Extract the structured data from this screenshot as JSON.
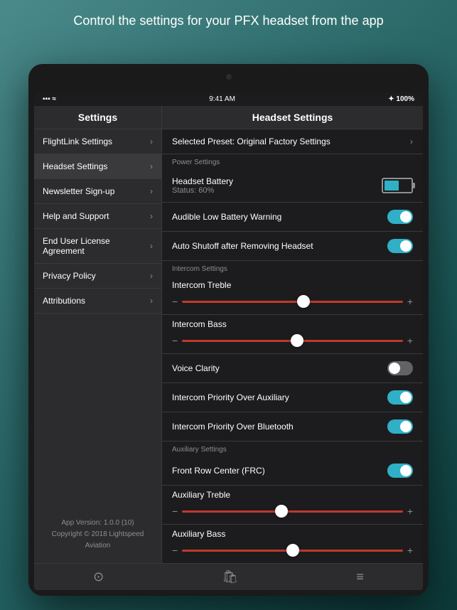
{
  "header": {
    "text": "Control the settings for your PFX headset from the app"
  },
  "status_bar": {
    "signal": "▪▪▪ ≈",
    "time": "9:41 AM",
    "battery": "✦ 100%"
  },
  "nav": {
    "left_title": "Settings",
    "right_title": "Headset Settings"
  },
  "sidebar": {
    "items": [
      {
        "label": "FlightLink Settings",
        "active": false
      },
      {
        "label": "Headset Settings",
        "active": true
      },
      {
        "label": "Newsletter Sign-up",
        "active": false
      },
      {
        "label": "Help and Support",
        "active": false
      },
      {
        "label": "End User License Agreement",
        "active": false
      },
      {
        "label": "Privacy Policy",
        "active": false
      },
      {
        "label": "Attributions",
        "active": false
      }
    ],
    "version": "App Version:  1.0.0 (10)",
    "copyright": "Copyright © 2018 Lightspeed Aviation"
  },
  "right_panel": {
    "selected_preset_label": "Selected Preset:  Original Factory Settings",
    "sections": [
      {
        "header": "Power Settings",
        "items": [
          {
            "type": "battery",
            "label": "Headset Battery",
            "sublabel": "Status:  60%",
            "percent": 60
          },
          {
            "type": "toggle",
            "label": "Audible Low Battery Warning",
            "on": true
          },
          {
            "type": "toggle",
            "label": "Auto Shutoff after Removing Headset",
            "on": true
          }
        ]
      },
      {
        "header": "Intercom Settings",
        "items": [
          {
            "type": "slider",
            "label": "Intercom Treble",
            "position": 0.55
          },
          {
            "type": "slider",
            "label": "Intercom Bass",
            "position": 0.52
          },
          {
            "type": "toggle",
            "label": "Voice Clarity",
            "on": false
          },
          {
            "type": "toggle",
            "label": "Intercom Priority Over Auxiliary",
            "on": true
          },
          {
            "type": "toggle",
            "label": "Intercom Priority Over Bluetooth",
            "on": true
          }
        ]
      },
      {
        "header": "Auxiliary Settings",
        "items": [
          {
            "type": "toggle",
            "label": "Front Row Center (FRC)",
            "on": true
          },
          {
            "type": "slider",
            "label": "Auxiliary Treble",
            "position": 0.45
          },
          {
            "type": "slider",
            "label": "Auxiliary Bass",
            "position": 0.5
          }
        ]
      }
    ]
  },
  "tab_bar": {
    "icons": [
      "⊙",
      "🛍",
      "≡"
    ]
  },
  "chevron": "›",
  "minus": "−",
  "plus": "+"
}
